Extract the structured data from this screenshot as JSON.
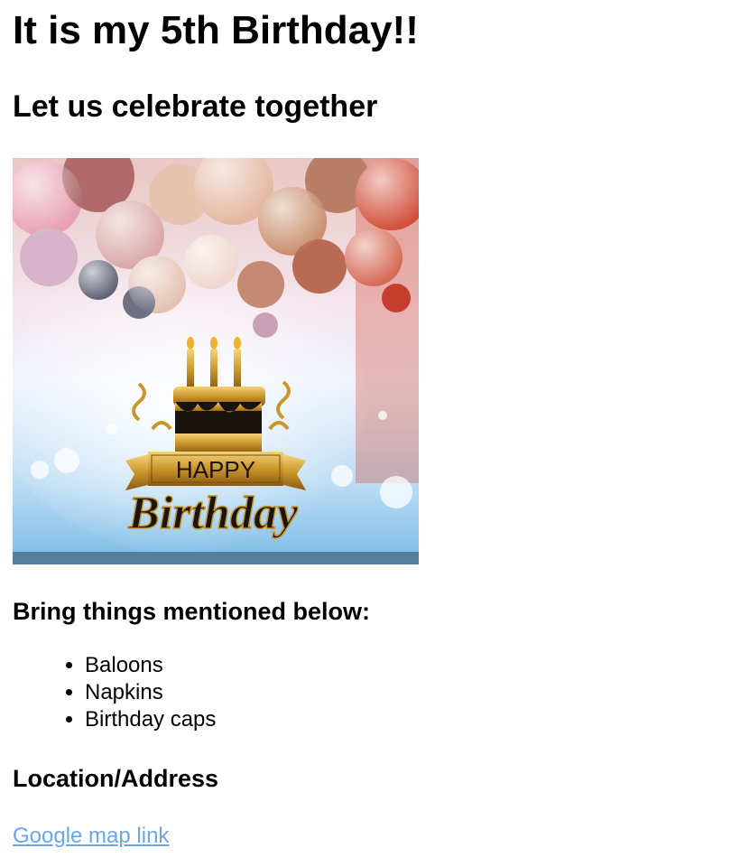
{
  "page": {
    "title": "It is my 5th Birthday!!",
    "subtitle": "Let us celebrate together",
    "banner_image": {
      "icon": "happy-birthday-cake-balloons-image",
      "line1": "HAPPY",
      "line2": "Birthday",
      "colors": {
        "gold": "#c9962a",
        "pink": "#e8a0b4",
        "sky": "#8cc4ec",
        "red": "#d2503c"
      }
    },
    "bring_heading": "Bring things mentioned below:",
    "bring_items": [
      "Baloons",
      "Napkins",
      "Birthday caps"
    ],
    "location_heading": "Location/Address",
    "map_link_text": "Google map link",
    "link_color": "#6aa6e8"
  }
}
